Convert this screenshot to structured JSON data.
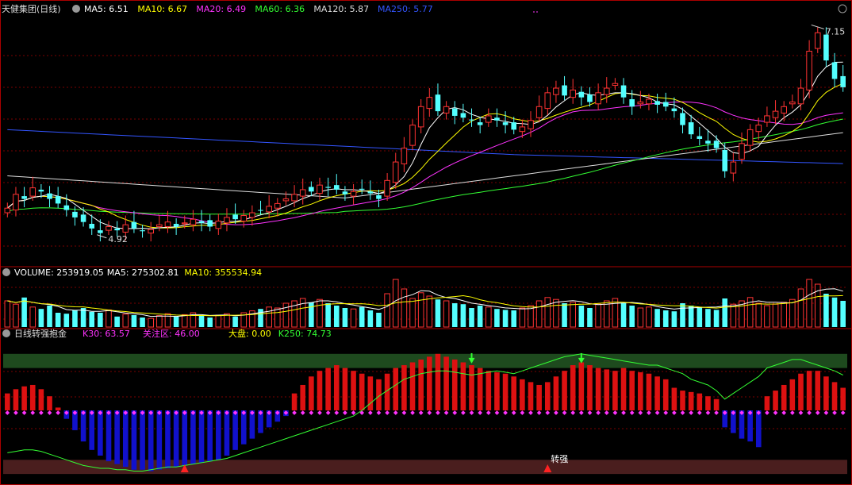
{
  "main": {
    "title": "天健集团(日线)",
    "ma": [
      {
        "label": "MA5: 6.51",
        "color": "#ffffff"
      },
      {
        "label": "MA10: 6.67",
        "color": "#ffff00"
      },
      {
        "label": "MA20: 6.49",
        "color": "#ff33ff"
      },
      {
        "label": "MA60: 6.36",
        "color": "#33ff33"
      },
      {
        "label": "MA120: 5.87",
        "color": "#dddddd"
      },
      {
        "label": "MA250: 5.77",
        "color": "#3355ff"
      }
    ],
    "high_label": "7.15",
    "low_label": "4.92"
  },
  "volume": {
    "labels": [
      {
        "label": "VOLUME: 253919.05",
        "color": "#ffffff"
      },
      {
        "label": "MA5: 275302.81",
        "color": "#ffffff"
      },
      {
        "label": "MA10: 355534.94",
        "color": "#ffff00"
      }
    ]
  },
  "indicator": {
    "title": "日线转强抱金",
    "labels": [
      {
        "label": "K30: 63.57",
        "color": "#ff33ff"
      },
      {
        "label": "关注区: 46.00",
        "color": "#ff33ff"
      },
      {
        "label": "大盘: 0.00",
        "color": "#ffff00"
      },
      {
        "label": "K250: 74.73",
        "color": "#33ff33"
      }
    ],
    "signal_label": "转强"
  },
  "colors": {
    "up": "#ff3333",
    "down": "#54ffff",
    "grid": "#7a0000",
    "indicator_up": "#dd1111",
    "indicator_down": "#1111cc"
  },
  "chart_data": [
    {
      "type": "candlestick",
      "title": "天健集团(日线)",
      "n_bars": 100,
      "y_range": [
        4.6,
        7.3
      ],
      "annotations": [
        {
          "text": "7.15",
          "kind": "high"
        },
        {
          "text": "4.92",
          "kind": "low"
        }
      ],
      "close": [
        5.2,
        5.35,
        5.3,
        5.42,
        5.38,
        5.3,
        5.25,
        5.18,
        5.1,
        5.05,
        4.98,
        4.93,
        5.0,
        4.96,
        5.02,
        4.98,
        4.95,
        4.97,
        5.02,
        5.05,
        5.0,
        5.04,
        5.08,
        5.04,
        5.0,
        5.06,
        5.1,
        5.08,
        5.12,
        5.15,
        5.18,
        5.22,
        5.25,
        5.3,
        5.35,
        5.4,
        5.38,
        5.45,
        5.42,
        5.4,
        5.35,
        5.38,
        5.4,
        5.36,
        5.3,
        5.5,
        5.7,
        5.85,
        6.1,
        6.3,
        6.4,
        6.25,
        6.3,
        6.2,
        6.18,
        6.15,
        6.1,
        6.2,
        6.15,
        6.1,
        6.05,
        6.08,
        6.15,
        6.3,
        6.45,
        6.5,
        6.42,
        6.48,
        6.4,
        6.35,
        6.45,
        6.5,
        6.55,
        6.4,
        6.3,
        6.35,
        6.38,
        6.32,
        6.3,
        6.25,
        6.1,
        6.0,
        5.95,
        5.9,
        5.85,
        5.6,
        5.7,
        5.9,
        6.05,
        6.1,
        6.2,
        6.25,
        6.3,
        6.35,
        6.5,
        6.9,
        7.1,
        6.8,
        6.6,
        6.51
      ]
    },
    {
      "type": "bar",
      "title": "VOLUME",
      "series": [
        {
          "name": "VOLUME",
          "values_relative": [
            0.55,
            0.48,
            0.62,
            0.42,
            0.38,
            0.45,
            0.3,
            0.28,
            0.35,
            0.4,
            0.32,
            0.3,
            0.36,
            0.22,
            0.27,
            0.25,
            0.2,
            0.18,
            0.24,
            0.28,
            0.22,
            0.26,
            0.3,
            0.24,
            0.2,
            0.25,
            0.28,
            0.22,
            0.3,
            0.34,
            0.38,
            0.42,
            0.4,
            0.5,
            0.55,
            0.6,
            0.52,
            0.58,
            0.5,
            0.45,
            0.4,
            0.38,
            0.42,
            0.35,
            0.3,
            0.7,
            1.0,
            0.8,
            0.6,
            0.72,
            0.65,
            0.58,
            0.55,
            0.5,
            0.48,
            0.4,
            0.45,
            0.42,
            0.38,
            0.36,
            0.35,
            0.4,
            0.45,
            0.55,
            0.62,
            0.58,
            0.5,
            0.52,
            0.45,
            0.4,
            0.48,
            0.55,
            0.6,
            0.5,
            0.45,
            0.4,
            0.42,
            0.38,
            0.35,
            0.33,
            0.5,
            0.45,
            0.42,
            0.38,
            0.36,
            0.6,
            0.48,
            0.55,
            0.62,
            0.5,
            0.45,
            0.48,
            0.52,
            0.58,
            0.8,
            1.0,
            0.9,
            0.7,
            0.62,
            0.55
          ]
        }
      ]
    },
    {
      "type": "bar",
      "title": "日线转强抱金",
      "y_range": [
        0,
        100
      ],
      "zones": [
        {
          "name": "upper",
          "from": 80,
          "to": 90
        },
        {
          "name": "lower",
          "from": 5,
          "to": 15
        }
      ],
      "series": [
        {
          "name": "K30",
          "values": [
            62,
            65,
            67,
            68,
            65,
            60,
            52,
            44,
            36,
            28,
            22,
            18,
            14,
            12,
            10,
            8,
            8,
            7,
            8,
            9,
            10,
            11,
            12,
            13,
            14,
            15,
            18,
            22,
            26,
            30,
            34,
            38,
            42,
            46,
            62,
            68,
            74,
            78,
            80,
            82,
            80,
            78,
            76,
            74,
            72,
            76,
            80,
            82,
            84,
            86,
            88,
            90,
            88,
            86,
            84,
            82,
            80,
            78,
            77,
            76,
            74,
            72,
            70,
            68,
            70,
            74,
            78,
            82,
            84,
            82,
            80,
            79,
            78,
            80,
            78,
            77,
            76,
            74,
            72,
            66,
            64,
            63,
            62,
            60,
            58,
            38,
            34,
            30,
            28,
            24,
            60,
            64,
            68,
            72,
            76,
            78,
            78,
            74,
            70,
            66
          ]
        },
        {
          "name": "K250",
          "values": [
            20,
            21,
            22,
            22,
            21,
            19,
            17,
            15,
            13,
            11,
            10,
            9,
            9,
            8,
            8,
            7,
            7,
            8,
            9,
            10,
            10,
            11,
            12,
            13,
            14,
            15,
            16,
            18,
            20,
            22,
            24,
            26,
            28,
            30,
            32,
            34,
            36,
            38,
            40,
            42,
            44,
            46,
            50,
            55,
            60,
            64,
            68,
            72,
            74,
            76,
            77,
            78,
            78,
            77,
            76,
            75,
            76,
            77,
            78,
            77,
            76,
            78,
            80,
            82,
            84,
            86,
            88,
            89,
            90,
            89,
            88,
            87,
            86,
            85,
            84,
            83,
            82,
            82,
            80,
            78,
            76,
            72,
            70,
            68,
            64,
            58,
            62,
            66,
            70,
            74,
            80,
            82,
            84,
            86,
            86,
            84,
            82,
            80,
            78,
            75
          ]
        }
      ],
      "markers": [
        {
          "type": "signal",
          "text": "转强"
        }
      ]
    }
  ]
}
